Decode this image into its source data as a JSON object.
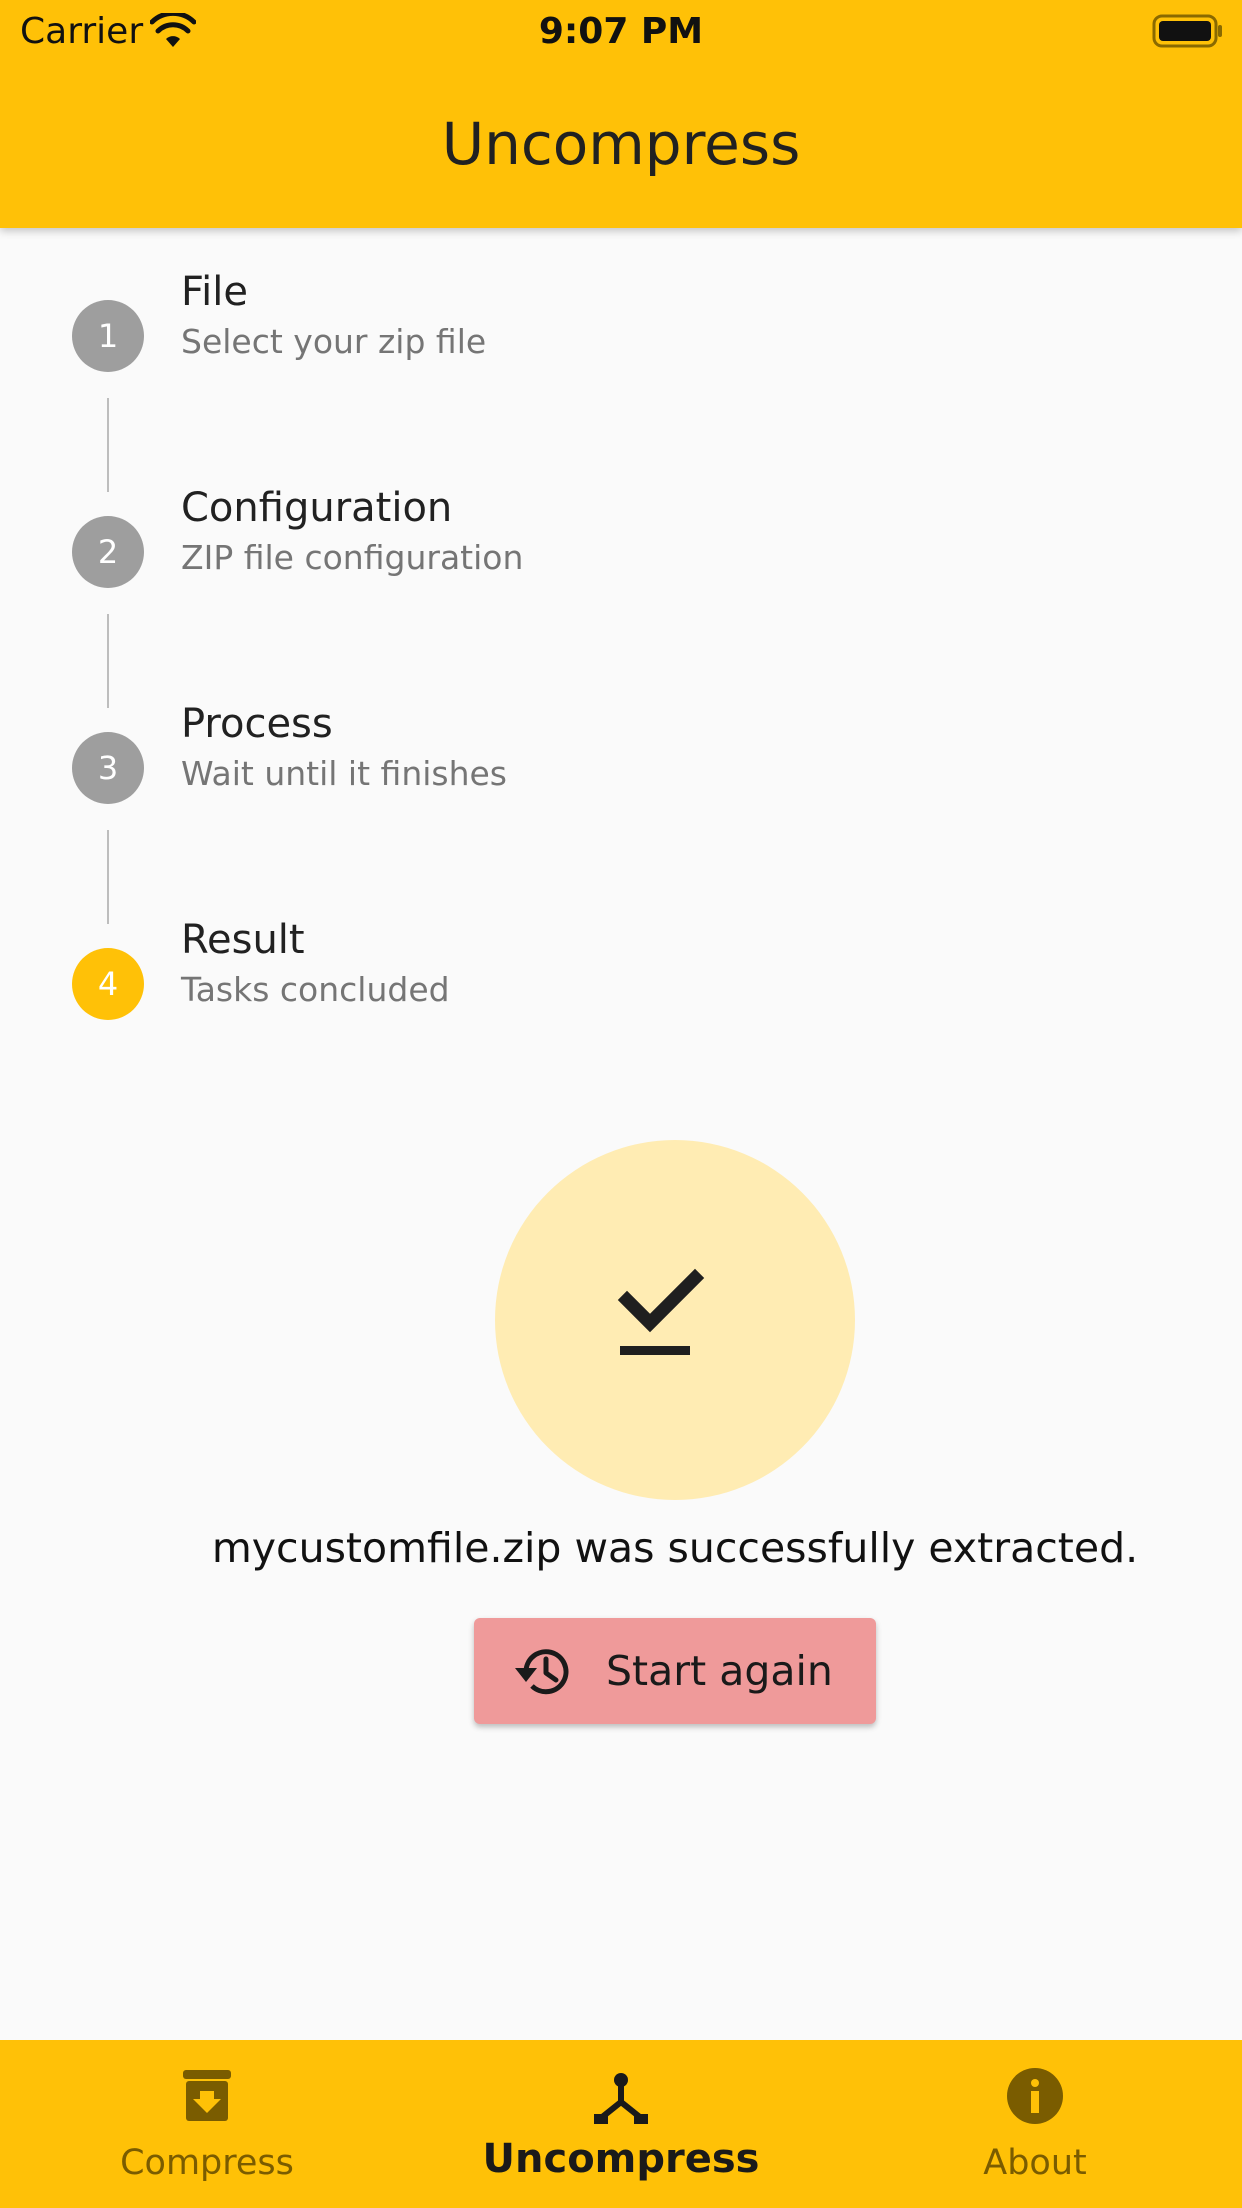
{
  "status_bar": {
    "carrier": "Carrier",
    "time": "9:07 PM",
    "icons": [
      "wifi-icon",
      "battery-icon"
    ]
  },
  "app_bar": {
    "title": "Uncompress"
  },
  "colors": {
    "primary": "#FFC107",
    "background": "#FAFAFA",
    "step_inactive": "#9E9E9E",
    "result_circle": "#FFECB3",
    "button": "#EF9A9A"
  },
  "stepper": {
    "current_step": 4,
    "steps": [
      {
        "number": "1",
        "title": "File",
        "subtitle": "Select your zip file"
      },
      {
        "number": "2",
        "title": "Configuration",
        "subtitle": "ZIP file configuration"
      },
      {
        "number": "3",
        "title": "Process",
        "subtitle": "Wait until it finishes"
      },
      {
        "number": "4",
        "title": "Result",
        "subtitle": "Tasks concluded"
      }
    ]
  },
  "result": {
    "icon": "done-icon",
    "message": "mycustomfile.zip was successfully extracted.",
    "button_label": "Start again",
    "button_icon": "history-icon"
  },
  "bottom_nav": {
    "active": "Uncompress",
    "items": [
      {
        "label": "Compress",
        "icon": "archive-icon"
      },
      {
        "label": "Uncompress",
        "icon": "unarchive-icon"
      },
      {
        "label": "About",
        "icon": "info-icon"
      }
    ]
  }
}
